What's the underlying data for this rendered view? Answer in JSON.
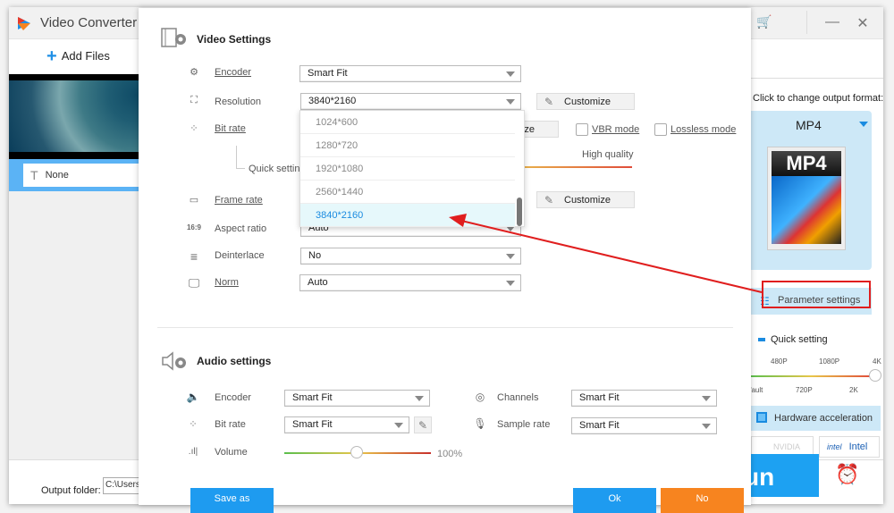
{
  "app": {
    "title": "Video Converter",
    "add_files_label": "Add Files",
    "file_item_subtitle": "None",
    "output_folder_label": "Output folder:",
    "output_folder_value": "C:\\Users\\",
    "run_label": "Run",
    "colors": {
      "accent": "#1e9bf0",
      "orange": "#f7841f",
      "highlight": "#e01e1e"
    }
  },
  "right_panel": {
    "hint": "Click to change output format:",
    "format_name": "MP4",
    "format_banner": "MP4",
    "parameter_settings_label": "Parameter settings",
    "quick_setting_label": "Quick setting",
    "quick_setting_ticks_top": [
      "480P",
      "1080P",
      "4K"
    ],
    "quick_setting_ticks_bottom": [
      "Default",
      "720P",
      "2K"
    ],
    "quick_setting_value": "4K",
    "hardware_acceleration_label": "Hardware acceleration",
    "nvidia_label": "NVIDIA",
    "intel_label": "Intel",
    "intel_logo": "intel"
  },
  "dialog": {
    "video_section_title": "Video Settings",
    "video_rows": {
      "encoder": {
        "label": "Encoder",
        "value": "Smart Fit"
      },
      "resolution": {
        "label": "Resolution",
        "value": "3840*2160"
      },
      "bit_rate": {
        "label": "Bit rate",
        "value": "Customize"
      },
      "quick_setting": {
        "label": "Quick setting",
        "right_label": "High quality"
      },
      "frame_rate": {
        "label": "Frame rate"
      },
      "aspect_ratio": {
        "label": "Aspect ratio",
        "value": "Auto",
        "icon_text": "16:9"
      },
      "deinterlace": {
        "label": "Deinterlace",
        "value": "No"
      },
      "norm": {
        "label": "Norm",
        "value": "Auto"
      }
    },
    "customize_label": "Customize",
    "vbr_mode_label": "VBR mode",
    "lossless_mode_label": "Lossless mode",
    "vbr_mode_checked": false,
    "lossless_mode_checked": false,
    "resolution_options": [
      "1024*600",
      "1280*720",
      "1920*1080",
      "2560*1440",
      "3840*2160"
    ],
    "resolution_selected": "3840*2160",
    "audio_section_title": "Audio settings",
    "audio_rows": {
      "encoder": {
        "label": "Encoder",
        "value": "Smart Fit"
      },
      "bit_rate": {
        "label": "Bit rate",
        "value": "Smart Fit"
      },
      "volume": {
        "label": "Volume",
        "value": "100%"
      },
      "channels": {
        "label": "Channels",
        "value": "Smart Fit"
      },
      "sample_rate": {
        "label": "Sample rate",
        "value": "Smart Fit"
      }
    },
    "volume_percent": 100,
    "save_as_label": "Save as",
    "ok_label": "Ok",
    "no_label": "No"
  }
}
